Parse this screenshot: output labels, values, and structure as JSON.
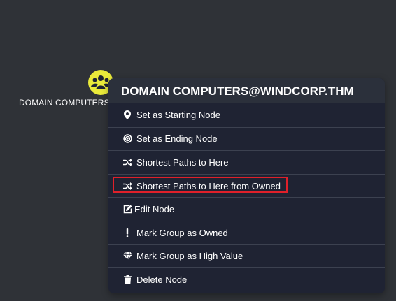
{
  "node": {
    "label": "DOMAIN COMPUTERS",
    "icon": "group-icon",
    "icon_color": "#eaea3a"
  },
  "context_menu": {
    "title": "DOMAIN COMPUTERS@WINDCORP.THM",
    "highlight_color": "#e0202a",
    "items": [
      {
        "label": "Set as Starting Node",
        "icon": "map-marker-icon"
      },
      {
        "label": "Set as Ending Node",
        "icon": "target-icon"
      },
      {
        "label": "Shortest Paths to Here",
        "icon": "shuffle-icon"
      },
      {
        "label": "Shortest Paths to Here from Owned",
        "icon": "shuffle-icon",
        "highlighted": true
      },
      {
        "label": "Edit Node",
        "icon": "edit-icon"
      },
      {
        "label": "Mark Group as Owned",
        "icon": "exclamation-icon"
      },
      {
        "label": "Mark Group as High Value",
        "icon": "gem-icon"
      },
      {
        "label": "Delete Node",
        "icon": "trash-icon"
      }
    ]
  }
}
